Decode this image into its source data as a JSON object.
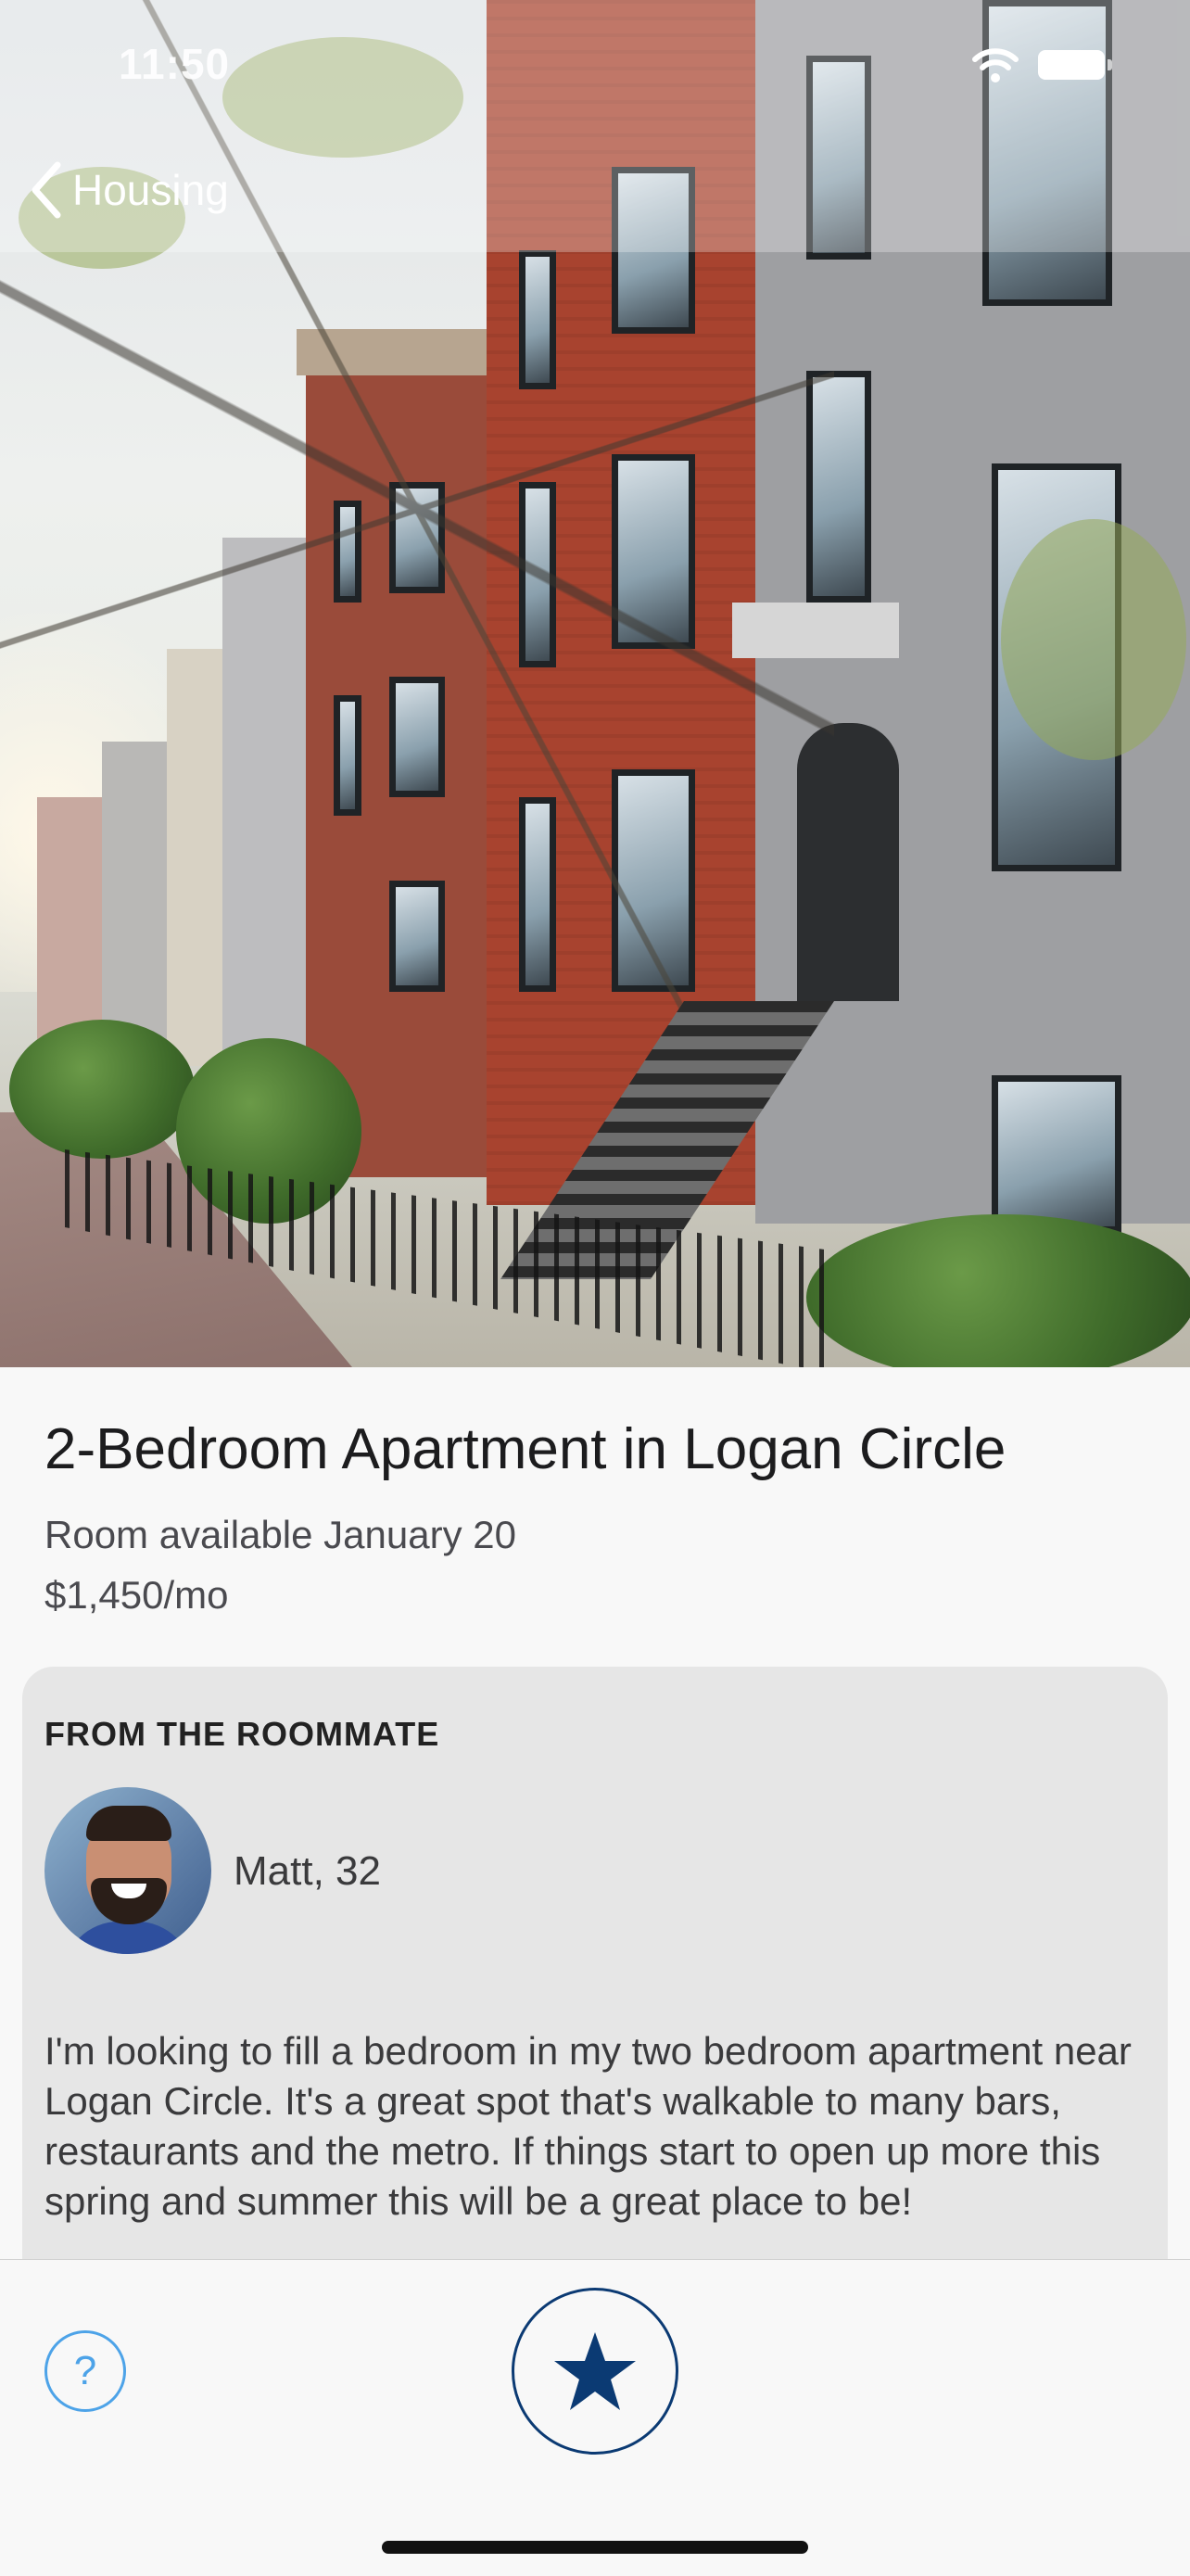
{
  "status_bar": {
    "time": "11:50"
  },
  "nav": {
    "back_label": "Housing",
    "back_icon": "chevron-left-icon"
  },
  "listing": {
    "title": "2-Bedroom Apartment in Logan Circle",
    "availability": "Room available January 20",
    "price": "$1,450/mo"
  },
  "roommate": {
    "heading": "FROM THE ROOMMATE",
    "name_age": "Matt, 32",
    "description": "I'm looking to fill a bedroom in my two bedroom apartment near Logan Circle. It's a great spot that's walkable to many bars, restaurants and the metro. If things start to open up more this spring and summer this will be a great place to be!"
  },
  "bottom_bar": {
    "help_label": "?",
    "favorite_icon": "star-icon"
  },
  "colors": {
    "accent_blue": "#4da3e8",
    "brand_navy": "#0b3a73",
    "card_background": "#e6e6e6"
  }
}
